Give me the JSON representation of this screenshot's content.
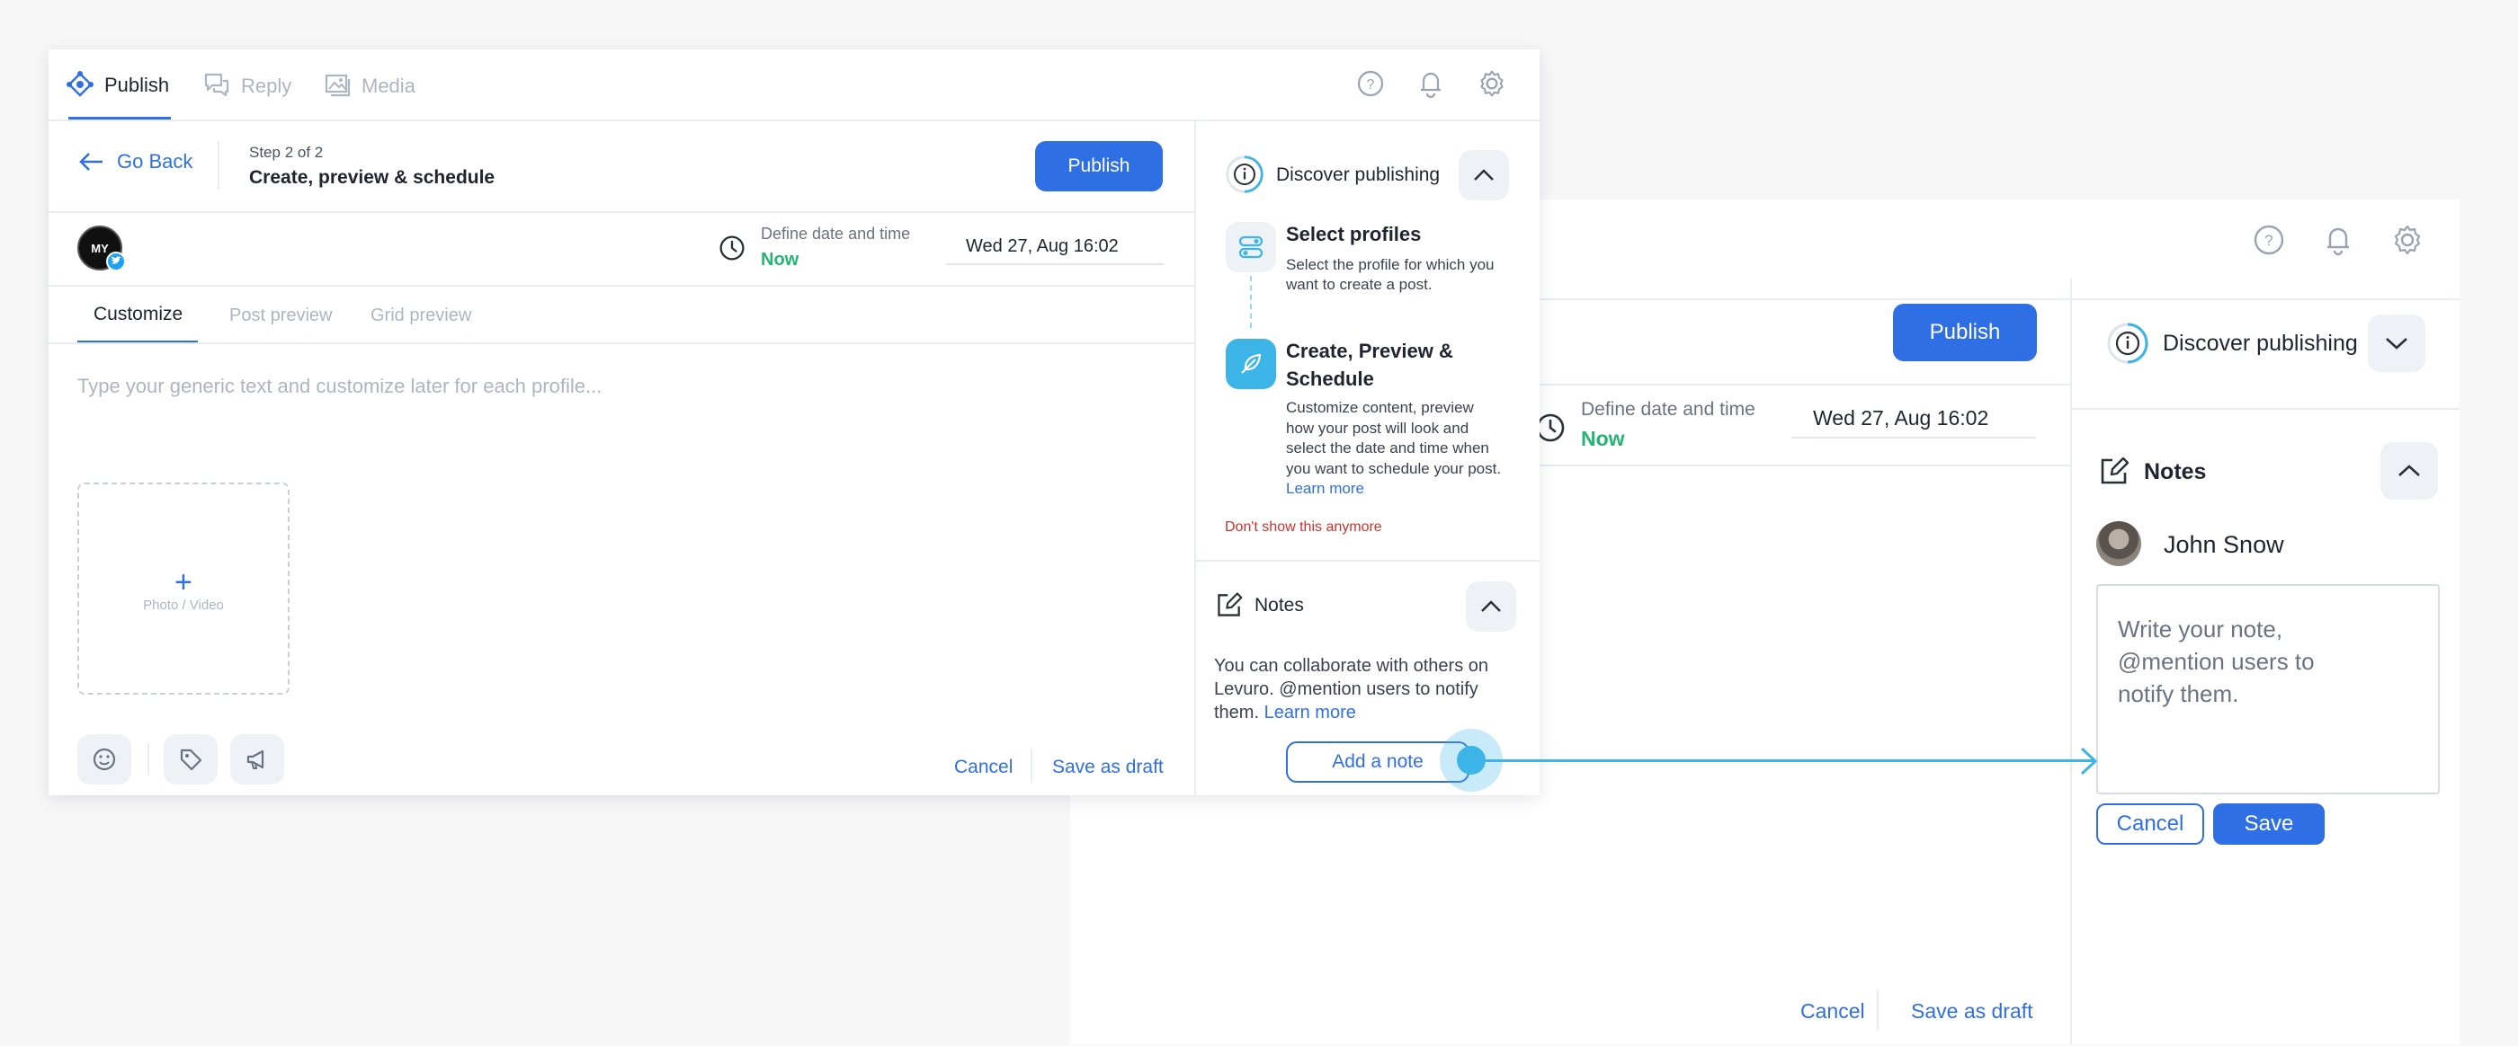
{
  "nav": {
    "tabs": [
      {
        "label": "Publish",
        "active": true
      },
      {
        "label": "Reply",
        "active": false
      },
      {
        "label": "Media",
        "active": false
      }
    ],
    "icons": [
      "help-icon",
      "bell-icon",
      "gear-icon"
    ]
  },
  "header": {
    "back_label": "Go Back",
    "step_label": "Step 2 of 2",
    "step_title": "Create, preview & schedule",
    "publish_label": "Publish"
  },
  "schedule": {
    "define_label": "Define date and time",
    "now_label": "Now",
    "date_value": "Wed 27, Aug 16:02"
  },
  "profile": {
    "avatar_text": "MY"
  },
  "editor": {
    "tabs": [
      {
        "label": "Customize",
        "active": true
      },
      {
        "label": "Post preview",
        "active": false
      },
      {
        "label": "Grid preview",
        "active": false
      }
    ],
    "placeholder": "Type your generic text and customize later for each profile...",
    "media_label": "Photo / Video",
    "cancel_label": "Cancel",
    "save_draft_label": "Save as draft"
  },
  "discover": {
    "title": "Discover publishing",
    "steps": [
      {
        "title": "Select profiles",
        "desc": "Select the profile for which you want to create a post."
      },
      {
        "title": "Create, Preview & Schedule",
        "desc": "Customize content, preview how your post will look and select the date and time when you want to schedule your post.",
        "link": "Learn more"
      }
    ],
    "dont_show": "Don't show this anymore"
  },
  "notes": {
    "title": "Notes",
    "desc": "You can collaborate with others on Levuro. @mention users to notify them.",
    "link": "Learn more",
    "add_label": "Add a note"
  },
  "note_editor": {
    "user_name": "John Snow",
    "placeholder": "Write your note, @mention users to notify them.",
    "cancel_label": "Cancel",
    "save_label": "Save"
  },
  "colors": {
    "accent": "#2f6fe6",
    "success": "#22b573",
    "danger": "#d0312d",
    "highlight": "#3db4e8"
  }
}
